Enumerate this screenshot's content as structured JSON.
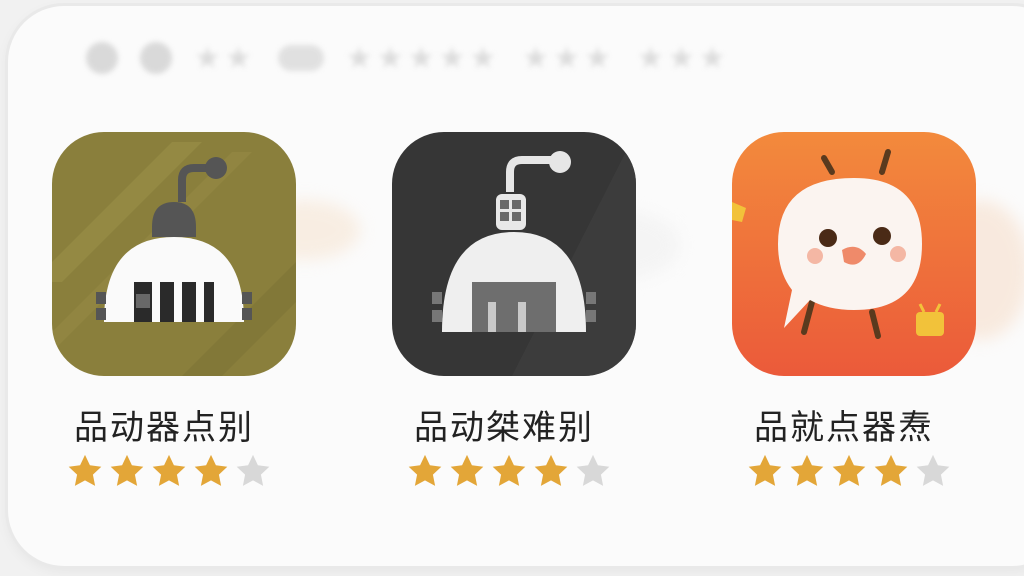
{
  "colors": {
    "star_filled": "#e3a638",
    "star_empty": "#d8d8d8",
    "icon1_bg": "#8a7f3c",
    "icon2_bg": "#363636",
    "icon3_bg": "#ef6f3a"
  },
  "apps": [
    {
      "name": "品动器点别",
      "icon": "robot-dome-icon",
      "rating": 4,
      "max_rating": 5
    },
    {
      "name": "品动桀难别",
      "icon": "robot-dome-dark-icon",
      "rating": 4,
      "max_rating": 5
    },
    {
      "name": "品就点器焘",
      "icon": "speech-bubble-bird-icon",
      "rating": 4,
      "max_rating": 5
    }
  ]
}
